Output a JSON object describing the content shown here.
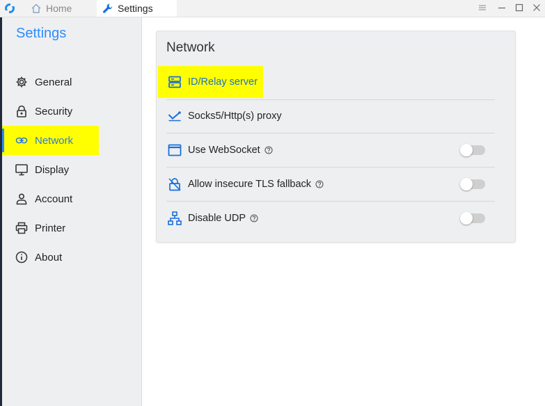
{
  "titlebar": {
    "tabs": [
      {
        "label": "Home",
        "icon": "home-icon"
      },
      {
        "label": "Settings",
        "icon": "wrench-icon"
      }
    ]
  },
  "sidebar": {
    "title": "Settings",
    "items": [
      {
        "label": "General",
        "icon": "gear-icon"
      },
      {
        "label": "Security",
        "icon": "lock-icon"
      },
      {
        "label": "Network",
        "icon": "link-icon",
        "active": true
      },
      {
        "label": "Display",
        "icon": "monitor-icon"
      },
      {
        "label": "Account",
        "icon": "person-icon"
      },
      {
        "label": "Printer",
        "icon": "printer-icon"
      },
      {
        "label": "About",
        "icon": "info-icon"
      }
    ]
  },
  "main": {
    "card_title": "Network",
    "rows": [
      {
        "label": "ID/Relay server",
        "icon": "server-icon"
      },
      {
        "label": "Socks5/Http(s) proxy",
        "icon": "proxy-icon"
      },
      {
        "label": "Use WebSocket",
        "icon": "window-icon",
        "toggle": false,
        "help": true
      },
      {
        "label": "Allow insecure TLS fallback",
        "icon": "unlock-icon",
        "toggle": false,
        "help": true
      },
      {
        "label": "Disable UDP",
        "icon": "network-tree-icon",
        "toggle": false,
        "help": true
      }
    ]
  },
  "colors": {
    "accent": "#2c8cff",
    "highlight": "#ffff00",
    "sidebar_bg": "#eeeff1"
  }
}
